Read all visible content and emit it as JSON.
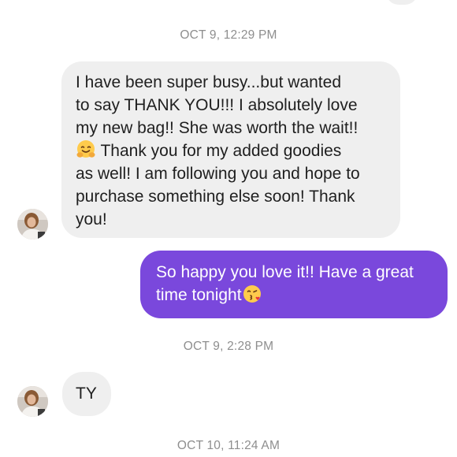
{
  "conversation": {
    "timestamps": [
      "OCT 9, 12:29 PM",
      "OCT 9, 2:28 PM",
      "OCT 10, 11:24 AM"
    ],
    "messages": [
      {
        "direction": "incoming",
        "lines": [
          "I have been super busy...but wanted",
          "to say THANK YOU!!!  I absolutely love",
          "my new bag!! She was worth the wait!!",
          " Thank you for my added goodies",
          "as well! I am following you and hope to",
          "purchase something else soon! Thank",
          "you!"
        ],
        "emoji": "hugging-face-emoji"
      },
      {
        "direction": "outgoing",
        "lines": [
          "So happy you love it!! Have a great",
          "time tonight"
        ],
        "emoji": "face-blowing-kiss-emoji"
      },
      {
        "direction": "incoming",
        "text": "TY"
      }
    ]
  },
  "colors": {
    "outgoing_bubble": "#7a48dc",
    "incoming_bubble": "#efefef",
    "timestamp_text": "#8e8e8e"
  }
}
